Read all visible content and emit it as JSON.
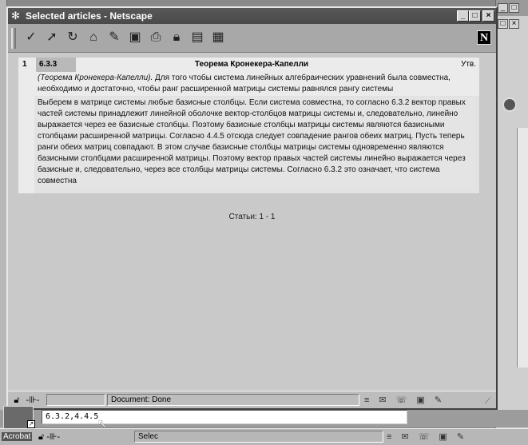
{
  "window": {
    "title": "Selected articles - Netscape",
    "minimize": "_",
    "maximize": "□",
    "close": "×"
  },
  "toolbar": {
    "icons": [
      "back-icon",
      "forward-icon",
      "reload-icon",
      "home-icon",
      "search-icon",
      "netscape-guide-icon",
      "print-icon",
      "security-icon",
      "shop-icon",
      "stop-icon"
    ],
    "logo": "N"
  },
  "article": {
    "number": "1",
    "code": "6.3.3",
    "title": "Теорема Кронекера-Капелли",
    "type": "Утв.",
    "statement_italic": "(Теорема Кронекера-Капелли).",
    "statement_rest": " Для того чтобы система линейных алгебраических уравнений была совместна, необходимо и достаточно, чтобы ранг расширенной матрицы системы равнялся рангу системы",
    "proof": "Выберем в матрице системы любые базисные столбцы. Если система совместна, то согласно 6.3.2 вектор правых частей системы принадлежит линейной оболочке вектор-столбцов матрицы системы и, следовательно, линейно выражается через ее базисные столбцы. Поэтому базисные столбцы матрицы системы являются базисными столбцами расширенной матрицы. Согласно 4.4.5 отсюда следует совпадение рангов обеих матриц. Пусть теперь ранги обеих матриц совпадают. В этом случае базисные столбцы матрицы системы одновременно являются базисными столбцами расширенной матрицы. Поэтому вектор правых частей системы линейно выражается через базисные и, следовательно, через все столбцы матрицы системы. Согласно 6.3.2 это означает, что система совместна"
  },
  "footer": {
    "count": "Статьи: 1 - 1"
  },
  "statusbar": {
    "text": "Document: Done"
  },
  "command": {
    "value": "6.3.2,4.4.5"
  },
  "taskbar": {
    "app_label": "Acrobat",
    "status_text": "Selec"
  }
}
